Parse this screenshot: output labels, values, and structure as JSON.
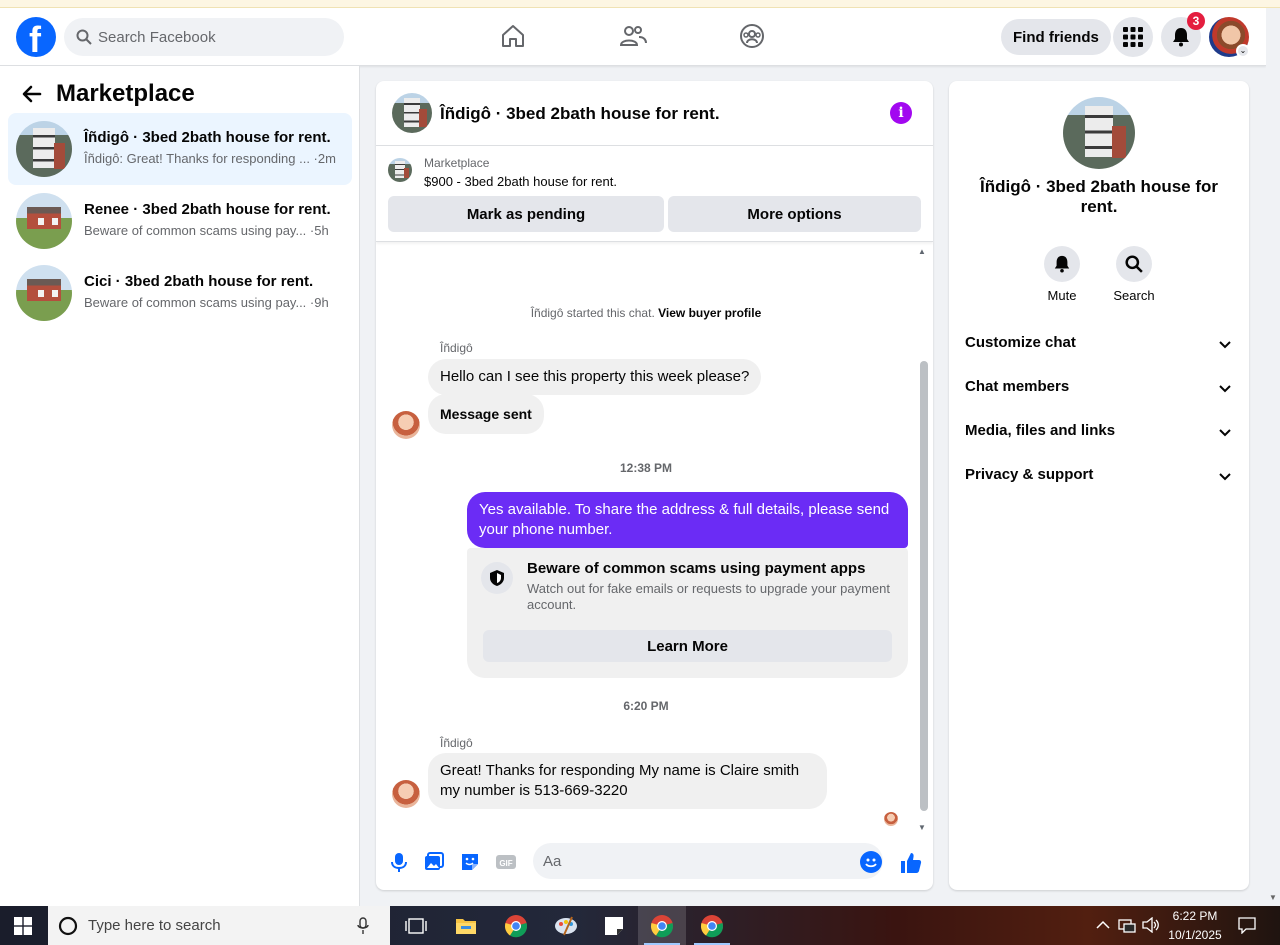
{
  "header": {
    "search_placeholder": "Search Facebook",
    "find_friends_label": "Find friends",
    "notification_count": "3"
  },
  "sidebar": {
    "title": "Marketplace",
    "conversations": [
      {
        "title": "Îñdigô · 3bed 2bath house for rent.",
        "preview": "Îñdigô: Great! Thanks for responding ... ·2m",
        "active": true
      },
      {
        "title": "Renee · 3bed 2bath house for rent.",
        "preview": "Beware of common scams using pay... ·5h",
        "active": false
      },
      {
        "title": "Cici · 3bed 2bath house for rent.",
        "preview": "Beware of common scams using pay... ·9h",
        "active": false
      }
    ]
  },
  "chat": {
    "title": "Îñdigô · 3bed 2bath house for rent.",
    "listing_label": "Marketplace",
    "listing_price": "$900 - 3bed 2bath house for rent.",
    "mark_pending_label": "Mark as pending",
    "more_options_label": "More options",
    "started_text": "Îñdigô started this chat.",
    "view_profile_label": "View buyer profile",
    "sender_name": "Îñdigô",
    "msg1": "Hello can I see this property this week please?",
    "msg2": "Message sent",
    "time1": "12:38 PM",
    "my_msg": "Yes available. To share the address & full details, please send your phone number.",
    "scam_title": "Beware of common scams using payment apps",
    "scam_desc": "Watch out for fake emails or requests to upgrade your payment account.",
    "learn_more_label": "Learn More",
    "time2": "6:20 PM",
    "msg3": "Great! Thanks for responding My name is Claire smith my number is 513-669-3220",
    "composer_placeholder": "Aa"
  },
  "info_panel": {
    "title": "Îñdigô · 3bed 2bath house for rent.",
    "mute_label": "Mute",
    "search_label": "Search",
    "rows": [
      "Customize chat",
      "Chat members",
      "Media, files and links",
      "Privacy & support"
    ]
  },
  "taskbar": {
    "search_placeholder": "Type here to search",
    "time": "6:22 PM",
    "date": "10/1/2025"
  },
  "colors": {
    "accent": "#0866ff",
    "my_bubble": "#6b2cf5",
    "info_icon": "#a208f0"
  }
}
